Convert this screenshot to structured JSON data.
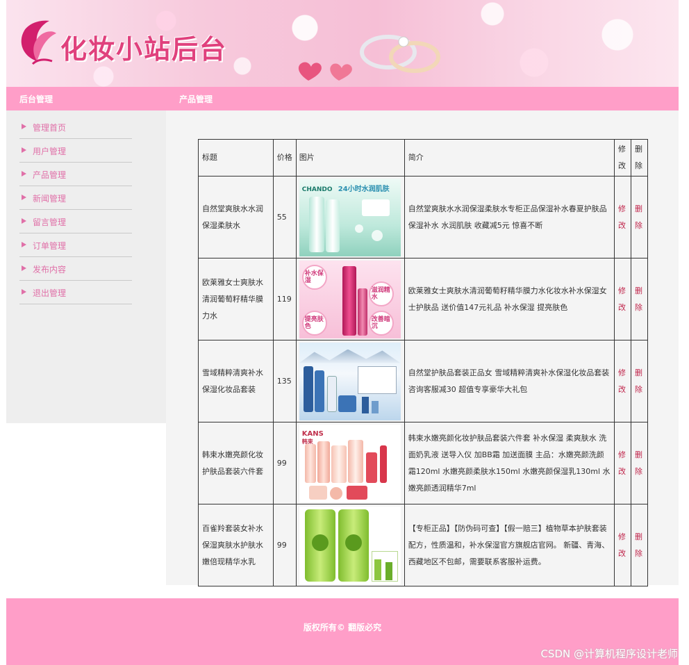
{
  "banner": {
    "title": "化妆小站后台"
  },
  "menubar": {
    "left_title": "后台管理",
    "right_title": "产品管理"
  },
  "sidebar": {
    "items": [
      {
        "label": "管理首页"
      },
      {
        "label": "用户管理"
      },
      {
        "label": "产品管理"
      },
      {
        "label": "新闻管理"
      },
      {
        "label": "留言管理"
      },
      {
        "label": "订单管理"
      },
      {
        "label": "发布内容"
      },
      {
        "label": "退出管理"
      }
    ]
  },
  "table": {
    "headers": {
      "title": "标题",
      "price": "价格",
      "image": "图片",
      "desc": "简介",
      "edit": "修改",
      "delete": "删除"
    },
    "rows": [
      {
        "title": "自然堂爽肤水水润保湿柔肤水",
        "price": "55",
        "image_captions": [
          "CHANDO",
          "24小时水润肌肤"
        ],
        "desc": "自然堂爽肤水水润保湿柔肤水专柜正品保湿补水春夏护肤品 保湿补水 水润肌肤 收藏减5元 惊喜不断",
        "edit": "修改",
        "delete": "删除"
      },
      {
        "title": "欧莱雅女士爽肤水清润葡萄籽精华膜力水",
        "price": "119",
        "image_captions": [
          "补水保湿",
          "滋润精水",
          "提亮肤色",
          "改善暗沉"
        ],
        "desc": "欧莱雅女士爽肤水清润葡萄籽精华膜力水化妆水补水保湿女士护肤品 送价值147元礼品 补水保湿 提亮肤色",
        "edit": "修改",
        "delete": "删除"
      },
      {
        "title": "雪域精粹清爽补水保湿化妆品套装",
        "price": "135",
        "image_captions": [],
        "desc": "自然堂护肤品套装正品女 雪域精粹清爽补水保湿化妆品套装 咨询客服减30 超值专享豪华大礼包",
        "edit": "修改",
        "delete": "删除"
      },
      {
        "title": "韩束水嫩亮颜化妆护肤品套装六件套",
        "price": "99",
        "image_captions": [
          "KANS",
          "韩束"
        ],
        "desc": "韩束水嫩亮颜化妆护肤品套装六件套 补水保湿 柔爽肤水 洗面奶乳液 送导入仪 加BB霜 加送面膜 主品：水嫩亮颜洗颜霜120ml 水嫩亮颜柔肤水150ml 水嫩亮颜保湿乳130ml 水嫩亮颜透润精华7ml",
        "edit": "修改",
        "delete": "删除"
      },
      {
        "title": "百雀羚套装女补水保湿爽肤水护肤水嫩倍现精华水乳",
        "price": "99",
        "image_captions": [],
        "desc": "【专柜正品】【防伪码可查】【假一赔三】植物草本护肤套装配方，性质温和，补水保湿官方旗舰店官网。 新疆、青海、西藏地区不包邮，需要联系客服补运费。",
        "edit": "修改",
        "delete": "删除"
      }
    ]
  },
  "footer": {
    "copyright": "版权所有© 翻版必究"
  },
  "watermark": "CSDN @计算机程序设计老师",
  "colors": {
    "pink_bar": "#ff9ec8",
    "menu_text": "#e070a8",
    "action": "#c0254b"
  }
}
